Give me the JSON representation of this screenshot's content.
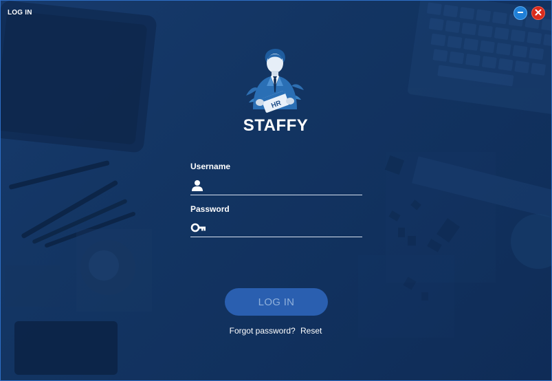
{
  "window": {
    "title": "LOG IN"
  },
  "brand": {
    "name": "STAFFY",
    "badge_text": "HR"
  },
  "form": {
    "username_label": "Username",
    "username_value": "",
    "password_label": "Password",
    "password_value": ""
  },
  "actions": {
    "login_label": "LOG IN",
    "forgot_text": "Forgot password?",
    "reset_label": "Reset"
  },
  "icons": {
    "minimize": "minimize-icon",
    "close": "close-icon",
    "username": "user-icon",
    "password": "key-icon"
  },
  "colors": {
    "background": "#133563",
    "minimize_button": "#1f7fd6",
    "close_button": "#d92b1c",
    "login_button": "#2a5fb0",
    "login_text": "#8fb0db",
    "text": "#ffffff"
  }
}
